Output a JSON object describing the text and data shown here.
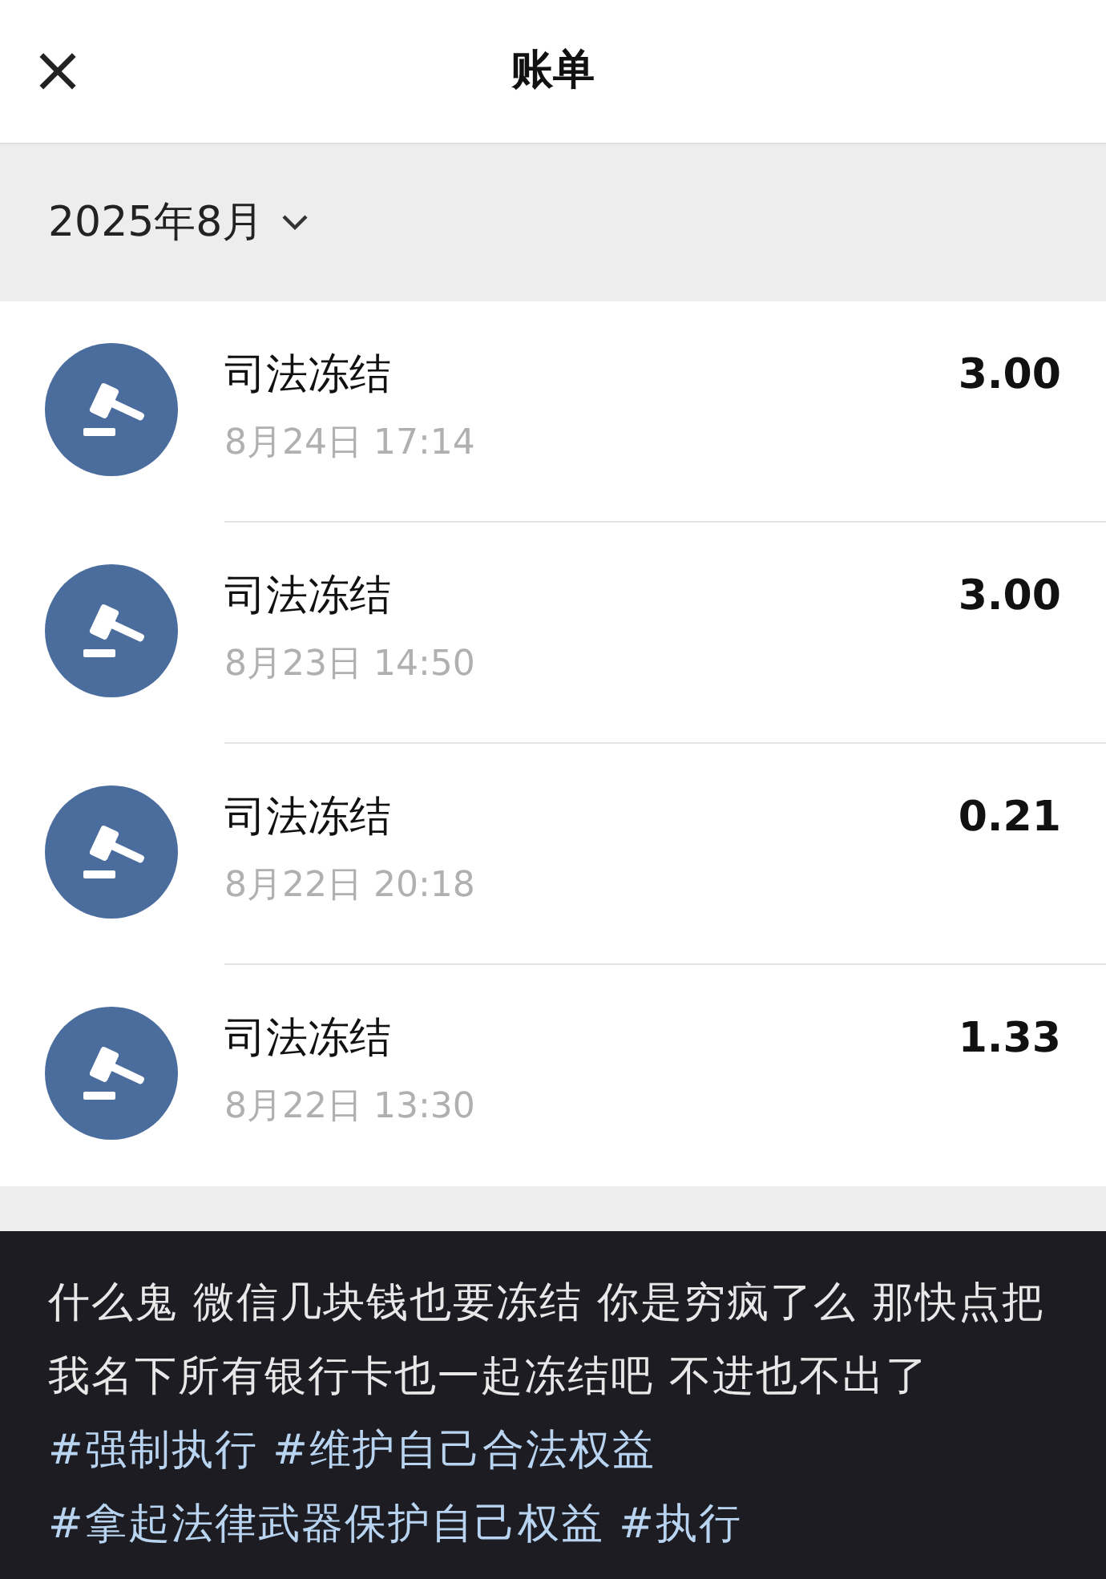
{
  "header": {
    "close_icon": "×",
    "title": "账单"
  },
  "month_filter": {
    "label": "2025年8月"
  },
  "transactions": [
    {
      "title": "司法冻结",
      "time": "8月24日 17:14",
      "amount": "3.00"
    },
    {
      "title": "司法冻结",
      "time": "8月23日 14:50",
      "amount": "3.00"
    },
    {
      "title": "司法冻结",
      "time": "8月22日 20:18",
      "amount": "0.21"
    },
    {
      "title": "司法冻结",
      "time": "8月22日 13:30",
      "amount": "1.33"
    }
  ],
  "caption": {
    "text": "什么鬼  微信几块钱也要冻结  你是穷疯了么  那快点把我名下所有银行卡也一起冻结吧  不进也不出了",
    "hashtags": [
      "#强制执行",
      "#维护自己合法权益",
      "#拿起法律武器保护自己权益",
      "#执行"
    ]
  }
}
